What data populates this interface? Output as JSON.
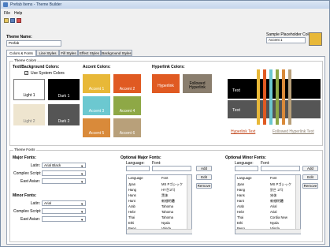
{
  "window": {
    "title": "Prefab Items - Theme Builder"
  },
  "menu": [
    "File",
    "Help"
  ],
  "theme_name": {
    "label": "Theme Name:",
    "value": "Prefab"
  },
  "sample_placeholder": {
    "label": "Sample Placeholder Color:",
    "value": "Accent 1",
    "color": "#e8b838"
  },
  "tabs": [
    "Colors & Fonts",
    "Line Styles",
    "Fill Styles",
    "Effect Styles",
    "Background Styles"
  ],
  "colors": {
    "group_title": "Theme Colors",
    "textbg_title": "Text/Background Colors:",
    "use_system_label": "Use System Colors",
    "textbg": [
      {
        "label": "Light 1",
        "bg": "#ffffff",
        "fg": "#000000"
      },
      {
        "label": "Dark 1",
        "bg": "#000000",
        "fg": "#ffffff"
      },
      {
        "label": "Light 2",
        "bg": "#eee5cf",
        "fg": "#7a7a7a"
      },
      {
        "label": "Dark 2",
        "bg": "#555555",
        "fg": "#ffffff"
      }
    ],
    "accent_title": "Accent Colors:",
    "accents": [
      {
        "label": "Accent 1",
        "bg": "#e8b838"
      },
      {
        "label": "Accent 2",
        "bg": "#e05a22"
      },
      {
        "label": "Accent 3",
        "bg": "#6cc8d0"
      },
      {
        "label": "Accent 4",
        "bg": "#8ea846"
      },
      {
        "label": "Accent 5",
        "bg": "#d98a3a"
      },
      {
        "label": "Accent 6",
        "bg": "#b8a07a"
      }
    ],
    "hyperlink_title": "Hyperlink Colors:",
    "hyperlink": {
      "label": "Hyperlink",
      "bg": "#e05a22"
    },
    "followed": {
      "label": "Followed Hyperlink",
      "bg": "#8a7e6e"
    },
    "preview": {
      "text_top": "Text",
      "text_bottom": "Text",
      "hyperlink_text": "Hyperlink Text",
      "followed_text": "Followed Hyperlink Text",
      "hyperlink_color": "#c0451a",
      "followed_color": "#8a7e6e"
    }
  },
  "fonts": {
    "group_title": "Theme Fonts",
    "major_title": "Major Fonts:",
    "minor_title": "Minor Fonts:",
    "latin_label": "Latin:",
    "complex_label": "Complex Script:",
    "east_label": "East Asian:",
    "major_latin": "Arial Black",
    "minor_latin": "Arial",
    "optional_major_title": "Optional Major Fonts:",
    "optional_minor_title": "Optional Minor Fonts:",
    "language_label": "Language:",
    "font_label": "Font:",
    "col_language": "Language",
    "col_font": "Font",
    "add": "Add",
    "edit": "Edit",
    "remove": "Remove",
    "major_rows": [
      [
        "Jpan",
        "MS Pゴシック"
      ],
      [
        "Hang",
        "HY견고딕"
      ],
      [
        "Hans",
        "黑体"
      ],
      [
        "Hant",
        "新細明體"
      ],
      [
        "Arab",
        "Tahoma"
      ],
      [
        "Hebr",
        "Tahoma"
      ],
      [
        "Thai",
        "Tahoma"
      ],
      [
        "Ethi",
        "Nyala"
      ],
      [
        "Beng",
        "Vrinda"
      ]
    ],
    "minor_rows": [
      [
        "Jpan",
        "MS Pゴシック"
      ],
      [
        "Hang",
        "맑은 고딕"
      ],
      [
        "Hans",
        "宋体"
      ],
      [
        "Hant",
        "新細明體"
      ],
      [
        "Arab",
        "Arial"
      ],
      [
        "Hebr",
        "Arial"
      ],
      [
        "Thai",
        "Cordia New"
      ],
      [
        "Ethi",
        "Nyala"
      ],
      [
        "Beng",
        "Vrinda"
      ]
    ]
  }
}
